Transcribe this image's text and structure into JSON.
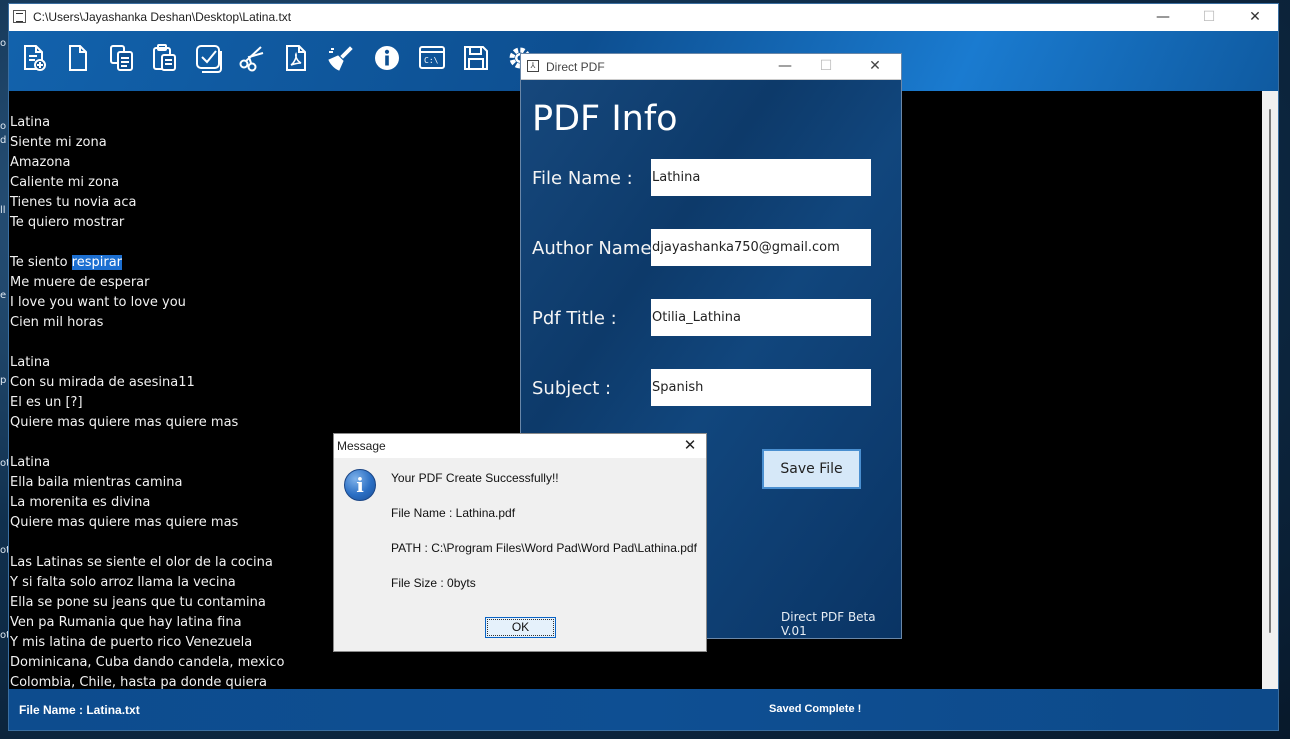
{
  "main_window": {
    "title": "C:\\Users\\Jayashanka Deshan\\Desktop\\Latina.txt",
    "controls": {
      "minimize": "—",
      "maximize": "☐",
      "close": "✕"
    }
  },
  "toolbar": {
    "tools": [
      {
        "name": "new-document-icon"
      },
      {
        "name": "blank-page-icon"
      },
      {
        "name": "copy-icon"
      },
      {
        "name": "paste-icon"
      },
      {
        "name": "select-all-icon"
      },
      {
        "name": "cut-icon"
      },
      {
        "name": "pdf-icon"
      },
      {
        "name": "clean-icon"
      },
      {
        "name": "info-icon"
      },
      {
        "name": "command-prompt-icon",
        "text": "C:\\"
      },
      {
        "name": "save-icon"
      },
      {
        "name": "settings-icon"
      }
    ]
  },
  "editor": {
    "lines": [
      "Latina",
      "Siente mi zona",
      "Amazona",
      "Caliente mi zona",
      "Tienes tu novia aca",
      "Te quiero mostrar",
      "",
      "Te siento respirar",
      "Me muere de esperar",
      "I love you want to love you",
      "Cien mil horas",
      "",
      "Latina",
      "Con su mirada de asesina11",
      "El es un [?]",
      "Quiere mas quiere mas quiere mas",
      "",
      "Latina",
      "Ella baila mientras camina",
      "La morenita es divina",
      "Quiere mas quiere mas quiere mas",
      "",
      "Las Latinas se siente el olor de la cocina",
      "Y si falta solo arroz llama la vecina",
      "Ella se pone su jeans que tu contamina",
      "Ven pa Rumania que hay latina fina",
      "Y mis latina de puerto rico Venezuela",
      "Dominicana, Cuba dando candela, mexico",
      "Colombia, Chile, hasta pa donde quiera"
    ],
    "highlight": {
      "line_index": 7,
      "before": "Te siento ",
      "selected": "respirar"
    }
  },
  "statusbar": {
    "file_name": "File Name : Latina.txt",
    "status": "Saved Complete !"
  },
  "pdf_window": {
    "title": "Direct PDF",
    "heading": "PDF Info",
    "fields": [
      {
        "label": "File Name :",
        "value": "Lathina"
      },
      {
        "label": "Author Name :",
        "value": "djayashanka750@gmail.com"
      },
      {
        "label": "Pdf Title :",
        "value": "Otilia_Lathina"
      },
      {
        "label": "Subject :",
        "value": "Spanish"
      }
    ],
    "save_button": "Save File",
    "version": "Direct PDF Beta V.01"
  },
  "message_dialog": {
    "title": "Message",
    "lines": [
      "Your PDF Create Successfully!!",
      "File Name : Lathina.pdf",
      "PATH : C:\\Program Files\\Word Pad\\Word Pad\\Lathina.pdf",
      "File Size : 0byts"
    ],
    "ok": "OK"
  },
  "desktop_fragments": [
    "o",
    "d",
    "ll",
    "p",
    "e",
    "ot",
    "p",
    "ot",
    "ot"
  ]
}
